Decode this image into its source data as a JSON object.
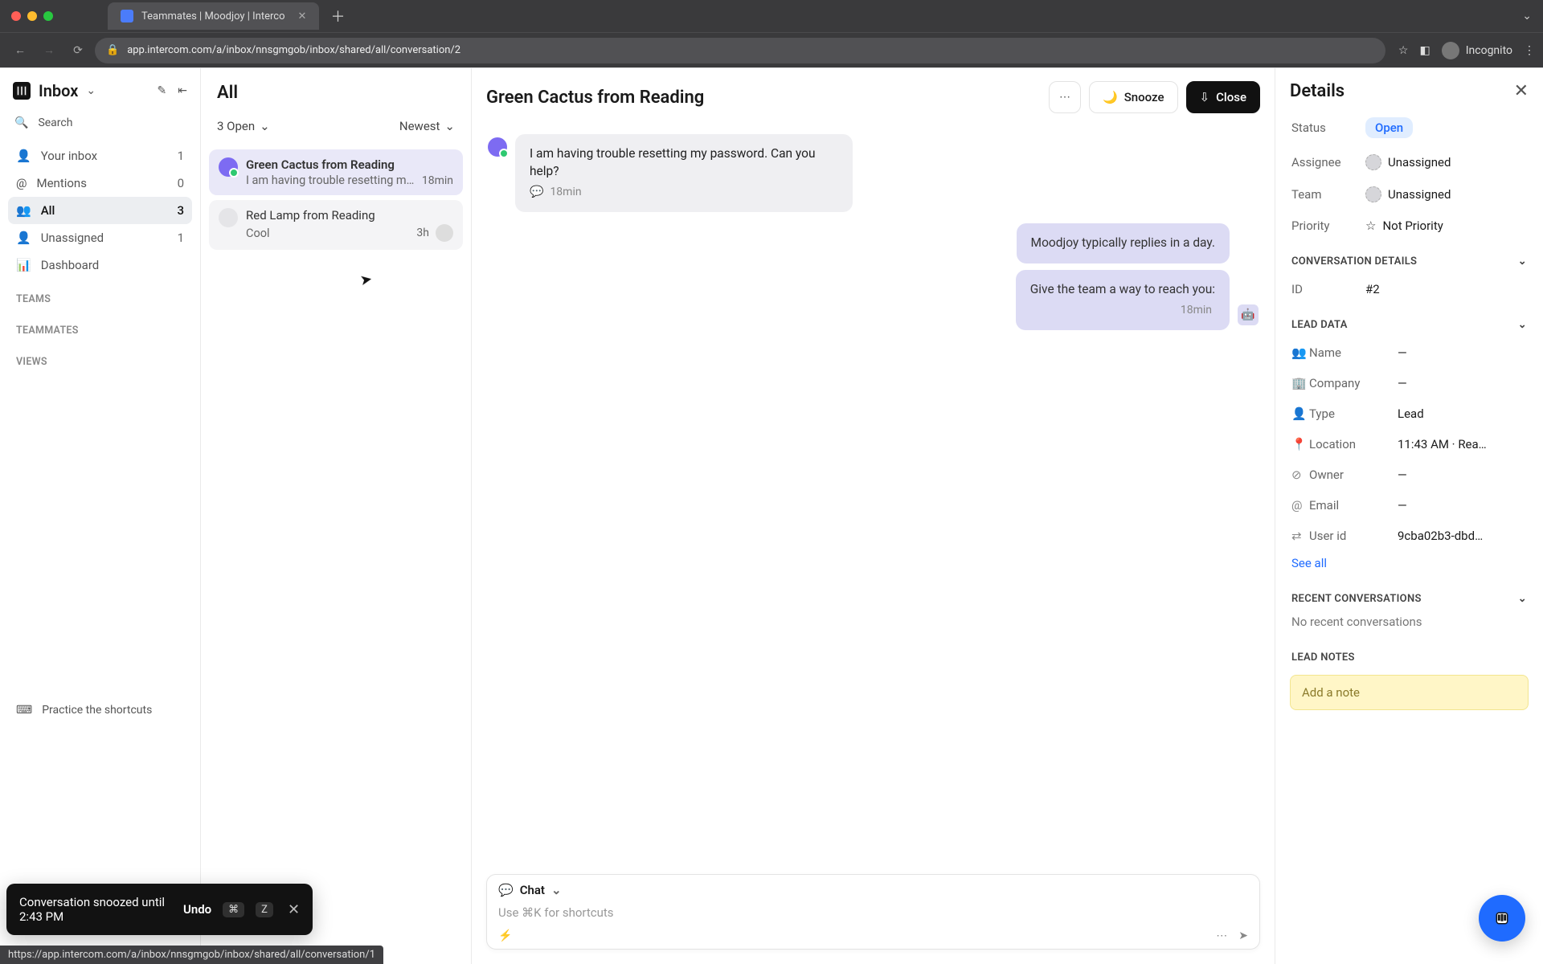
{
  "browser": {
    "tab_title": "Teammates | Moodjoy | Interco",
    "url": "app.intercom.com/a/inbox/nnsgmgob/inbox/shared/all/conversation/2",
    "incognito_label": "Incognito"
  },
  "sidebar": {
    "title": "Inbox",
    "search": "Search",
    "nav": [
      {
        "icon": "user",
        "label": "Your inbox",
        "count": "1"
      },
      {
        "icon": "at",
        "label": "Mentions",
        "count": "0"
      },
      {
        "icon": "people",
        "label": "All",
        "count": "3",
        "active": true
      },
      {
        "icon": "user",
        "label": "Unassigned",
        "count": "1"
      },
      {
        "icon": "chart",
        "label": "Dashboard",
        "count": ""
      }
    ],
    "sections": [
      "TEAMS",
      "TEAMMATES",
      "VIEWS"
    ],
    "shortcuts": "Practice the shortcuts"
  },
  "list": {
    "title": "All",
    "filter_open": "3 Open",
    "sort": "Newest",
    "items": [
      {
        "name": "Green Cactus from Reading",
        "preview": "I am having trouble resetting my p…",
        "time": "18min",
        "selected": true,
        "avatar": "purple",
        "online": true
      },
      {
        "name": "Red Lamp from Reading",
        "preview": "Cool",
        "time": "3h",
        "selected": false,
        "avatar": "gray",
        "online": false,
        "hover": true
      }
    ]
  },
  "chat": {
    "title": "Green Cactus from Reading",
    "snooze": "Snooze",
    "close": "Close",
    "messages_in": {
      "text": "I am having trouble resetting my password. Can you help?",
      "time": "18min"
    },
    "messages_out_1": "Moodjoy typically replies in a day.",
    "messages_out_2": "Give the team a way to reach you:",
    "out_time": "18min",
    "composer_mode": "Chat",
    "composer_placeholder": "Use ⌘K for shortcuts"
  },
  "details": {
    "title": "Details",
    "status_k": "Status",
    "status_v": "Open",
    "assignee_k": "Assignee",
    "assignee_v": "Unassigned",
    "team_k": "Team",
    "team_v": "Unassigned",
    "priority_k": "Priority",
    "priority_v": "Not Priority",
    "conv_h": "CONVERSATION DETAILS",
    "id_k": "ID",
    "id_v": "#2",
    "lead_h": "LEAD DATA",
    "lead": [
      {
        "icon": "user",
        "k": "Name",
        "v": "—"
      },
      {
        "icon": "building",
        "k": "Company",
        "v": "—"
      },
      {
        "icon": "person",
        "k": "Type",
        "v": "Lead"
      },
      {
        "icon": "pin",
        "k": "Location",
        "v": "11:43 AM · Rea…"
      },
      {
        "icon": "owner",
        "k": "Owner",
        "v": "—"
      },
      {
        "icon": "at",
        "k": "Email",
        "v": "—"
      },
      {
        "icon": "swap",
        "k": "User id",
        "v": "9cba02b3-dbd…"
      }
    ],
    "see_all": "See all",
    "recent_h": "RECENT CONVERSATIONS",
    "recent_empty": "No recent conversations",
    "notes_h": "LEAD NOTES",
    "note_placeholder": "Add a note"
  },
  "toast": {
    "text": "Conversation snoozed until 2:43 PM",
    "undo": "Undo",
    "k1": "⌘",
    "k2": "Z"
  },
  "statusbar": "https://app.intercom.com/a/inbox/nnsgmgob/inbox/shared/all/conversation/1"
}
